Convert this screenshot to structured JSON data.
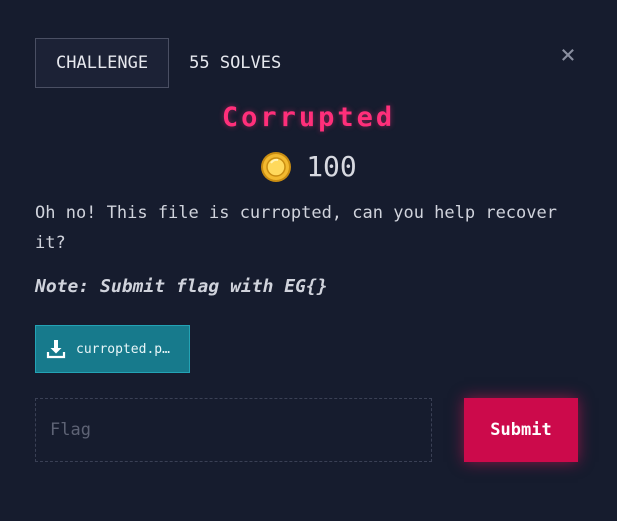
{
  "tabs": {
    "challenge": "CHALLENGE",
    "solves": "55 SOLVES"
  },
  "close_icon": "×",
  "challenge": {
    "title": "Corrupted",
    "points": "100",
    "description": "Oh no! This file is curropted, can you help recover it?",
    "note": "Note: Submit flag with EG{}"
  },
  "file": {
    "name": "curropted.png",
    "display": "curropted.p…",
    "icon": "download-icon"
  },
  "form": {
    "placeholder": "Flag",
    "value": "",
    "submit_label": "Submit"
  },
  "colors": {
    "accent": "#ff2f7a",
    "submit": "#cc0a4b",
    "file_button": "#177a8c",
    "background": "#161c2e"
  }
}
